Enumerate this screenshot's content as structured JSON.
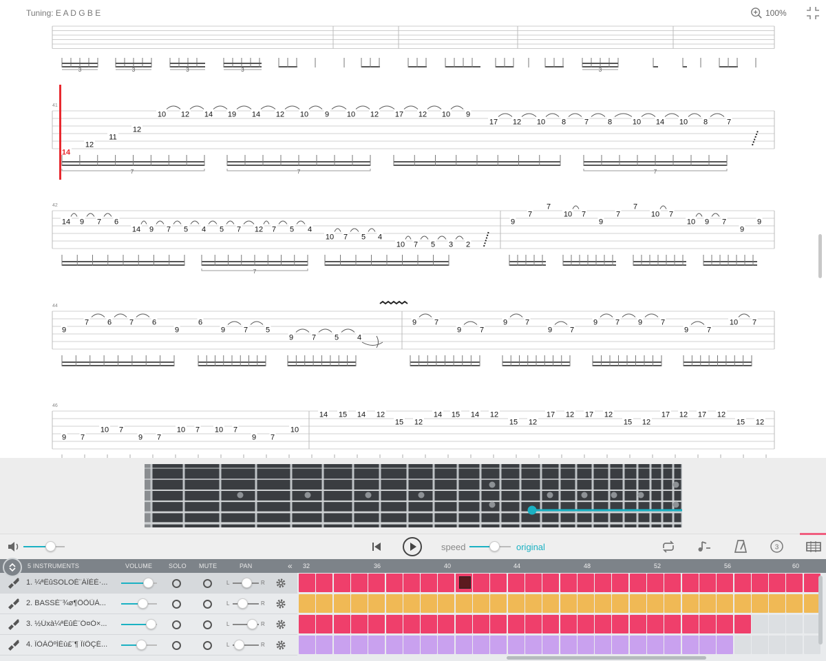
{
  "header": {
    "tuning_label": "Tuning: E A D G B E",
    "zoom_label": "100%"
  },
  "score": {
    "rows": [
      {
        "measure_numbers": [],
        "notes": []
      },
      {
        "measure_numbers": [
          "41"
        ],
        "notes": [
          {
            "t": "14",
            "s": 5,
            "hl": true
          },
          {
            "t": "12",
            "s": 4
          },
          {
            "t": "11",
            "s": 3
          },
          {
            "t": "12",
            "s": 2
          },
          {
            "t": "10",
            "s": 0
          },
          {
            "t": "12",
            "s": 0
          },
          {
            "t": "14",
            "s": 0
          },
          {
            "t": "19",
            "s": 0
          },
          {
            "t": "14",
            "s": 0
          },
          {
            "t": "12",
            "s": 0
          },
          {
            "t": "10",
            "s": 0
          },
          {
            "t": "9",
            "s": 0
          },
          {
            "t": "10",
            "s": 0
          },
          {
            "t": "12",
            "s": 0
          },
          {
            "t": "17",
            "s": 0
          },
          {
            "t": "12",
            "s": 0
          },
          {
            "t": "10",
            "s": 0
          },
          {
            "t": "9",
            "s": 0
          },
          {
            "t": "17",
            "s": 1
          },
          {
            "t": "12",
            "s": 1
          },
          {
            "t": "10",
            "s": 1
          },
          {
            "t": "8",
            "s": 1
          },
          {
            "t": "7",
            "s": 1
          },
          {
            "t": "8",
            "s": 1
          },
          {
            "t": "10",
            "s": 1
          },
          {
            "t": "14",
            "s": 1
          },
          {
            "t": "10",
            "s": 1
          },
          {
            "t": "8",
            "s": 1
          },
          {
            "t": "7",
            "s": 1
          }
        ],
        "tuplets": [
          "7",
          "7",
          "7"
        ]
      },
      {
        "measure_numbers": [
          "42"
        ],
        "notes": [
          {
            "t": "14",
            "s": 1
          },
          {
            "t": "9",
            "s": 1
          },
          {
            "t": "7",
            "s": 1
          },
          {
            "t": "6",
            "s": 1
          },
          {
            "t": "14",
            "s": 2
          },
          {
            "t": "9",
            "s": 2
          },
          {
            "t": "7",
            "s": 2
          },
          {
            "t": "5",
            "s": 2
          },
          {
            "t": "4",
            "s": 2
          },
          {
            "t": "5",
            "s": 2
          },
          {
            "t": "7",
            "s": 2
          },
          {
            "t": "12",
            "s": 2
          },
          {
            "t": "7",
            "s": 2
          },
          {
            "t": "5",
            "s": 2
          },
          {
            "t": "4",
            "s": 2
          },
          {
            "t": "10",
            "s": 3
          },
          {
            "t": "7",
            "s": 3
          },
          {
            "t": "5",
            "s": 3
          },
          {
            "t": "4",
            "s": 3
          },
          {
            "t": "10",
            "s": 4
          },
          {
            "t": "7",
            "s": 4
          },
          {
            "t": "5",
            "s": 4
          },
          {
            "t": "3",
            "s": 4
          },
          {
            "t": "2",
            "s": 4
          },
          {
            "t": "9",
            "s": 1
          },
          {
            "t": "7",
            "s": 0
          },
          {
            "t": "7",
            "s": -1
          },
          {
            "t": "10",
            "s": 0
          },
          {
            "t": "7",
            "s": 0
          },
          {
            "t": "9",
            "s": 1
          },
          {
            "t": "7",
            "s": 0
          },
          {
            "t": "7",
            "s": -1
          },
          {
            "t": "10",
            "s": 0
          },
          {
            "t": "7",
            "s": 0
          },
          {
            "t": "10",
            "s": 1
          },
          {
            "t": "9",
            "s": 1
          },
          {
            "t": "7",
            "s": 1
          },
          {
            "t": "9",
            "s": 2
          },
          {
            "t": "9",
            "s": 1
          }
        ],
        "tuplets": [
          "7"
        ]
      },
      {
        "measure_numbers": [
          "44"
        ],
        "notes": [
          {
            "t": "9",
            "s": 2
          },
          {
            "t": "7",
            "s": 1
          },
          {
            "t": "6",
            "s": 1
          },
          {
            "t": "7",
            "s": 1
          },
          {
            "t": "6",
            "s": 1
          },
          {
            "t": "9",
            "s": 2
          },
          {
            "t": "6",
            "s": 1
          },
          {
            "t": "9",
            "s": 2
          },
          {
            "t": "7",
            "s": 2
          },
          {
            "t": "5",
            "s": 2
          },
          {
            "t": "9",
            "s": 3
          },
          {
            "t": "7",
            "s": 3
          },
          {
            "t": "5",
            "s": 3
          },
          {
            "t": "4",
            "s": 3
          },
          {
            "t": "9",
            "s": 1
          },
          {
            "t": "7",
            "s": 1
          },
          {
            "t": "9",
            "s": 2
          },
          {
            "t": "7",
            "s": 2
          },
          {
            "t": "9",
            "s": 1
          },
          {
            "t": "7",
            "s": 1
          },
          {
            "t": "9",
            "s": 2
          },
          {
            "t": "7",
            "s": 2
          },
          {
            "t": "9",
            "s": 1
          },
          {
            "t": "7",
            "s": 1
          },
          {
            "t": "9",
            "s": 1
          },
          {
            "t": "7",
            "s": 1
          },
          {
            "t": "9",
            "s": 2
          },
          {
            "t": "7",
            "s": 2
          },
          {
            "t": "10",
            "s": 1
          },
          {
            "t": "7",
            "s": 1
          }
        ],
        "tuplets": []
      },
      {
        "measure_numbers": [
          "46"
        ],
        "notes": [
          {
            "t": "9",
            "s": 3
          },
          {
            "t": "7",
            "s": 3
          },
          {
            "t": "10",
            "s": 2
          },
          {
            "t": "7",
            "s": 2
          },
          {
            "t": "9",
            "s": 3
          },
          {
            "t": "7",
            "s": 3
          },
          {
            "t": "10",
            "s": 2
          },
          {
            "t": "7",
            "s": 2
          },
          {
            "t": "10",
            "s": 2
          },
          {
            "t": "7",
            "s": 2
          },
          {
            "t": "9",
            "s": 3
          },
          {
            "t": "7",
            "s": 3
          },
          {
            "t": "10",
            "s": 2
          },
          {
            "t": "14",
            "s": 0
          },
          {
            "t": "15",
            "s": 0
          },
          {
            "t": "14",
            "s": 0
          },
          {
            "t": "12",
            "s": 0
          },
          {
            "t": "15",
            "s": 1
          },
          {
            "t": "12",
            "s": 1
          },
          {
            "t": "14",
            "s": 0
          },
          {
            "t": "15",
            "s": 0
          },
          {
            "t": "14",
            "s": 0
          },
          {
            "t": "12",
            "s": 0
          },
          {
            "t": "15",
            "s": 1
          },
          {
            "t": "12",
            "s": 1
          },
          {
            "t": "17",
            "s": 0
          },
          {
            "t": "12",
            "s": 0
          },
          {
            "t": "17",
            "s": 0
          },
          {
            "t": "12",
            "s": 0
          },
          {
            "t": "15",
            "s": 1
          },
          {
            "t": "12",
            "s": 1
          },
          {
            "t": "17",
            "s": 0
          },
          {
            "t": "12",
            "s": 0
          },
          {
            "t": "17",
            "s": 0
          },
          {
            "t": "12",
            "s": 0
          },
          {
            "t": "15",
            "s": 1
          },
          {
            "t": "12",
            "s": 1
          }
        ],
        "tuplets": []
      }
    ],
    "top_tuplets": [
      "3",
      "3",
      "3",
      "3",
      "3"
    ]
  },
  "transport": {
    "speed_label": "speed",
    "speed_value": "original",
    "volume_level": 0.6,
    "speed_level": 0.5
  },
  "tracks_header": {
    "count_label": "5 INSTRUMENTS",
    "volume": "VOLUME",
    "solo": "SOLO",
    "mute": "MUTE",
    "pan": "PAN",
    "ruler": [
      "32",
      "36",
      "40",
      "44",
      "48",
      "52",
      "56",
      "60"
    ]
  },
  "tracks": [
    {
      "name": "1. ¼ªËûSOLOÉ¨ÁÏÈÈ·...",
      "volume": 0.75,
      "pan": "L",
      "pan_r": "R",
      "color": "#ef3f6b",
      "filled": 30,
      "selected": true,
      "pan_level": 0.5
    },
    {
      "name": "2. BASSÉ¨¾ø¶ÔÕÜÀ...",
      "volume": 0.6,
      "pan": "L",
      "pan_r": "R",
      "color": "#f0b955",
      "filled": 30,
      "selected": false,
      "pan_level": 0.35
    },
    {
      "name": "3. ½Úxà¼ªËûÉ¨Ó¤Ó×...",
      "volume": 0.82,
      "pan": "L",
      "pan_r": "R",
      "color": "#ef3f6b",
      "filled": 26,
      "selected": false,
      "pan_level": 0.7
    },
    {
      "name": "4. ÏÒÀÖºÍÉù£¨¶ ÏïÖÇÉ...",
      "volume": 0.55,
      "pan": "L",
      "pan_r": "R",
      "color": "#c9a1ef",
      "filled": 25,
      "selected": false,
      "pan_level": 0.2
    }
  ],
  "colors": {
    "accent": "#1ab1c3",
    "cursor": "#e8292f",
    "track_red": "#ef3f6b",
    "track_orange": "#f0b955",
    "track_purple": "#c9a1ef",
    "empty": "#dcdfe2"
  },
  "icons": [
    "zoom-in-icon",
    "collapse-icon",
    "volume-icon",
    "skip-back-icon",
    "play-icon",
    "loop-icon",
    "pitch-icon",
    "metronome-icon",
    "countdown-icon",
    "fretboard-toggle-icon",
    "guitar-icon",
    "bass-icon",
    "gear-icon"
  ]
}
